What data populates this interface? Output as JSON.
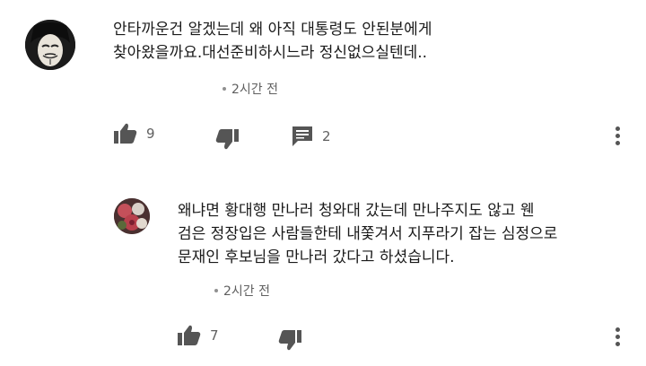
{
  "comments": [
    {
      "avatar_icon": "guy-fawkes-mask-avatar",
      "text_lines": [
        "안타까운건 알겠는데 왜 아직 대통령도 안된분에게",
        "찾아왔을까요.대선준비하시느라 정신없으실텐데.."
      ],
      "timestamp": "2시간 전",
      "likes": "9",
      "replies": "2"
    },
    {
      "avatar_icon": "flower-avatar",
      "text_lines": [
        "왜냐면 황대행 만나러 청와대 갔는데 만나주지도 않고 웬",
        "검은 정장입은 사람들한테 내쫓겨서 지푸라기 잡는 심정으로",
        "문재인 후보님을 만나러 갔다고 하셨습니다."
      ],
      "timestamp": "2시간 전",
      "likes": "7"
    }
  ],
  "colors": {
    "icon": "#555555",
    "meta_text": "#606060"
  }
}
